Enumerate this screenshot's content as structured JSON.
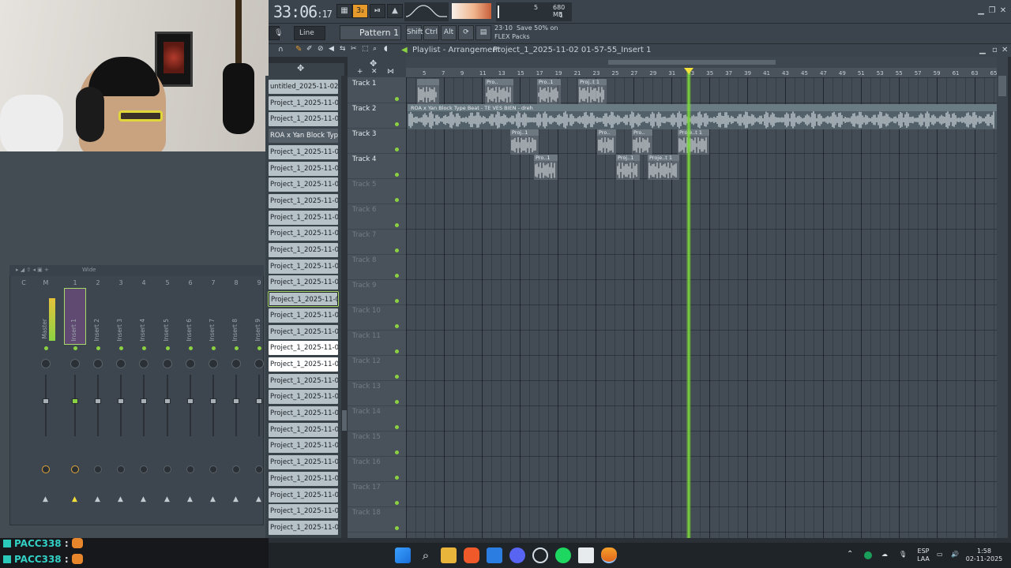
{
  "topbar": {
    "time_main": "33:06",
    "time_sub": "17",
    "cpu_value": "5",
    "memory": "680 MB",
    "polyphony": "1"
  },
  "toolbar2": {
    "snap": "Line",
    "pattern": "Pattern 1",
    "shift": "Shift",
    "ctrl": "Ctrl",
    "alt": "Alt",
    "hint_date": "23·10",
    "hint_text": "Save 50% on FLEX Packs"
  },
  "playlist": {
    "title": "Playlist - Arrangement",
    "breadcrumb": "Project_1_2025-11-02 01-57-55_Insert 1",
    "ruler_numbers": [
      "5",
      "7",
      "9",
      "11",
      "13",
      "15",
      "17",
      "19",
      "21",
      "23",
      "25",
      "27",
      "29",
      "31",
      "33",
      "35",
      "37",
      "39",
      "41",
      "43",
      "45",
      "47",
      "49",
      "51",
      "53",
      "55",
      "57",
      "59",
      "61",
      "63",
      "65"
    ],
    "tracks": [
      "Track 1",
      "Track 2",
      "Track 3",
      "Track 4",
      "Track 5",
      "Track 6",
      "Track 7",
      "Track 8",
      "Track 9",
      "Track 10",
      "Track 11",
      "Track 12",
      "Track 13",
      "Track 14",
      "Track 15",
      "Track 16",
      "Track 17",
      "Track 18",
      "Track 19"
    ],
    "big_clip_label": "ROA x Yan Block Type Beat - TE VES BIEN - dreh",
    "clip_labels": [
      "Pro..",
      "Pro..",
      "Pro..1",
      "Proj..t 1",
      "Proj..1",
      "Pro..",
      "Pro..",
      "Proje..t 1",
      "Pro..1",
      "Proj..1",
      "Proje..t 1"
    ]
  },
  "browser": {
    "items": [
      "untitled_2025-11-02 00-…",
      "Project_1_2025-11-02 0…",
      "Project_1_2025-11-02 0…",
      "ROA x Yan Block Type…",
      "Project_1_2025-11-02 0…",
      "Project_1_2025-11-02 0…",
      "Project_1_2025-11-02 0…",
      "Project_1_2025-11-02 0…",
      "Project_1_2025-11-02 0…",
      "Project_1_2025-11-02 0…",
      "Project_1_2025-11-02 0…",
      "Project_1_2025-11-02 0…",
      "Project_1_2025-11-02 0…",
      "Project_1_2025-11-02 0…",
      "Project_1_2025-11-02 0…",
      "Project_1_2025-11-02 0…",
      "Project_1_2025-11-02 0…",
      "Project_1_2025-11-02 0…",
      "Project_1_2025-11-02 0…",
      "Project_1_2025-11-02 0…",
      "Project_1_2025-11-02 0…",
      "Project_1_2025-11-02 0…",
      "Project_1_2025-11-02 0…",
      "Project_1_2025-11-02 0…",
      "Project_1_2025-11-02 0…",
      "Project_1_2025-11-02 0…",
      "Project_1_2025-11-02 0…",
      "Project_1_2025-11-02 0…"
    ]
  },
  "mixer": {
    "preset": "Wide",
    "columns": [
      "C",
      "M",
      "1",
      "2",
      "3",
      "4",
      "5",
      "6",
      "7",
      "8",
      "9"
    ],
    "strips": [
      "Master",
      "Insert 1",
      "Insert 2",
      "Insert 3",
      "Insert 4",
      "Insert 5",
      "Insert 6",
      "Insert 7",
      "Insert 8",
      "Insert 9"
    ]
  },
  "chat": {
    "lines": [
      {
        "user": "PACC338",
        "sep": ":"
      },
      {
        "user": "PACC338",
        "sep": ":"
      }
    ]
  },
  "taskbar": {
    "lang_top": "ESP",
    "lang_bottom": "LAA",
    "clock_time": "1:58",
    "clock_date": "02-11-2025"
  },
  "colors": {
    "accent": "#7ddc39",
    "playhead_marker": "#f3e03a",
    "record_button": "#e69a2c",
    "chat_name": "#33d0c5"
  }
}
